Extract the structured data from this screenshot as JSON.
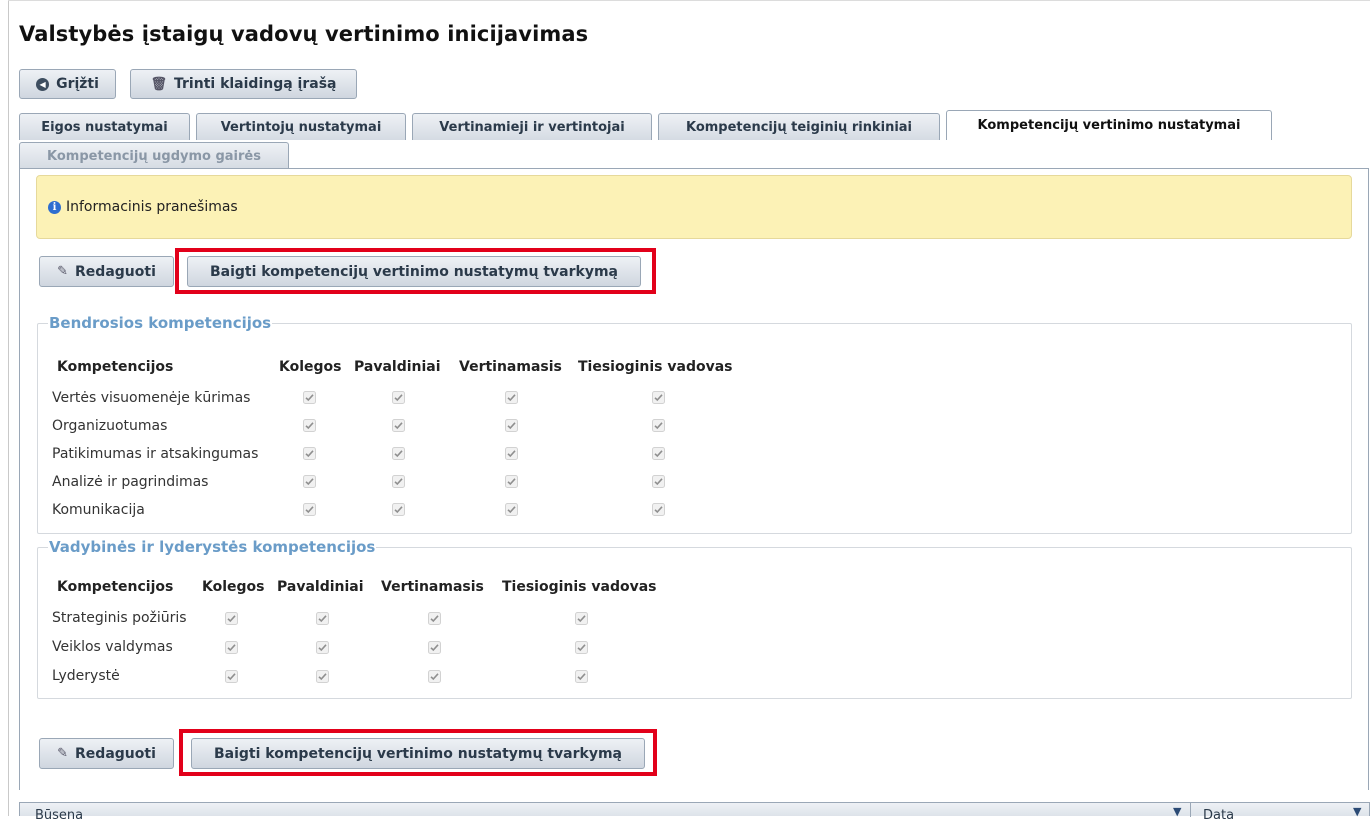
{
  "page_title": "Valstybės įstaigų vadovų vertinimo inicijavimas",
  "toolbar": {
    "back_label": "Grįžti",
    "delete_label": "Trinti klaidingą įrašą"
  },
  "tabs": [
    {
      "label": "Eigos nustatymai"
    },
    {
      "label": "Vertintojų nustatymai"
    },
    {
      "label": "Vertinamieji ir vertintojai"
    },
    {
      "label": "Kompetencijų teiginių rinkiniai"
    },
    {
      "label": "Kompetencijų vertinimo nustatymai",
      "active": true
    },
    {
      "label": "Kompetencijų ugdymo gairės",
      "disabled": true
    }
  ],
  "info_message": "Informacinis pranešimas",
  "actions": {
    "edit_label": "Redaguoti",
    "finish_label": "Baigti kompetencijų vertinimo nustatymų tvarkymą",
    "highlight_color": "#e2001a"
  },
  "sections": [
    {
      "title": "Bendrosios kompetencijos",
      "columns": [
        "Kompetencijos",
        "Kolegos",
        "Pavaldiniai",
        "Vertinamasis",
        "Tiesioginis vadovas"
      ],
      "rows": [
        {
          "name": "Vertės visuomenėje kūrimas",
          "checks": [
            true,
            true,
            true,
            true
          ]
        },
        {
          "name": "Organizuotumas",
          "checks": [
            true,
            true,
            true,
            true
          ]
        },
        {
          "name": "Patikimumas ir atsakingumas",
          "checks": [
            true,
            true,
            true,
            true
          ]
        },
        {
          "name": "Analizė ir pagrindimas",
          "checks": [
            true,
            true,
            true,
            true
          ]
        },
        {
          "name": "Komunikacija",
          "checks": [
            true,
            true,
            true,
            true
          ]
        }
      ]
    },
    {
      "title": "Vadybinės ir lyderystės kompetencijos",
      "columns": [
        "Kompetencijos",
        "Kolegos",
        "Pavaldiniai",
        "Vertinamasis",
        "Tiesioginis vadovas"
      ],
      "rows": [
        {
          "name": "Strateginis požiūris",
          "checks": [
            true,
            true,
            true,
            true
          ]
        },
        {
          "name": "Veiklos valdymas",
          "checks": [
            true,
            true,
            true,
            true
          ]
        },
        {
          "name": "Lyderystė",
          "checks": [
            true,
            true,
            true,
            true
          ]
        }
      ]
    }
  ],
  "bottom_table": {
    "columns": [
      "Būsena",
      "Data"
    ]
  }
}
